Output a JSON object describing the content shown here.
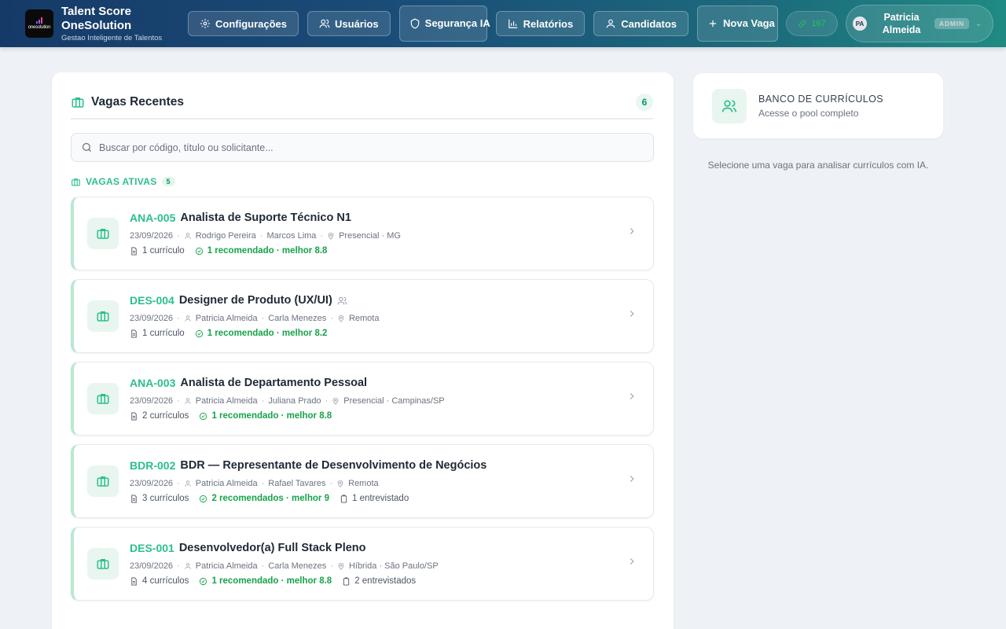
{
  "header": {
    "logo_text": "onesolution",
    "brand_title": "Talent Score OneSolution",
    "brand_subtitle": "Gestao Inteligente de Talentos",
    "nav": {
      "config": "Configurações",
      "users": "Usuários",
      "security": "Segurança IA",
      "reports": "Relatórios",
      "candidates": "Candidatos",
      "new_job": "Nova Vaga"
    },
    "link_count": "167",
    "user": {
      "initials": "PA",
      "name": "Patricia Almeida",
      "role": "ADMIN"
    }
  },
  "panel": {
    "title": "Vagas Recentes",
    "count": "6",
    "search_placeholder": "Buscar por código, título ou solicitante...",
    "section_label": "VAGAS ATIVAS",
    "section_count": "5"
  },
  "jobs": [
    {
      "code": "ANA-005",
      "title": "Analista de Suporte Técnico N1",
      "date": "23/09/2026",
      "requester": "Rodrigo Pereira",
      "recruiter": "Marcos Lima",
      "location": "Presencial · MG",
      "resumes": "1 currículo",
      "recommended": "1 recomendado · melhor 8.8",
      "interviewed": ""
    },
    {
      "code": "DES-004",
      "title": "Designer de Produto (UX/UI)",
      "date": "23/09/2026",
      "requester": "Patricia Almeida",
      "recruiter": "Carla Menezes",
      "location": "Remota",
      "resumes": "1 currículo",
      "recommended": "1 recomendado · melhor 8.2",
      "interviewed": ""
    },
    {
      "code": "ANA-003",
      "title": "Analista de Departamento Pessoal",
      "date": "23/09/2026",
      "requester": "Patricia Almeida",
      "recruiter": "Juliana Prado",
      "location": "Presencial · Campinas/SP",
      "resumes": "2 currículos",
      "recommended": "1 recomendado · melhor 8.8",
      "interviewed": ""
    },
    {
      "code": "BDR-002",
      "title": "BDR — Representante de Desenvolvimento de Negócios",
      "date": "23/09/2026",
      "requester": "Patricia Almeida",
      "recruiter": "Rafael Tavares",
      "location": "Remota",
      "resumes": "3 currículos",
      "recommended": "2 recomendados · melhor 9",
      "interviewed": "1 entrevistado"
    },
    {
      "code": "DES-001",
      "title": "Desenvolvedor(a) Full Stack Pleno",
      "date": "23/09/2026",
      "requester": "Patricia Almeida",
      "recruiter": "Carla Menezes",
      "location": "Híbrida · São Paulo/SP",
      "resumes": "4 currículos",
      "recommended": "1 recomendado · melhor 8.8",
      "interviewed": "2 entrevistados"
    }
  ],
  "side": {
    "bank_title": "BANCO DE CURRÍCULOS",
    "bank_subtitle": "Acesse o pool completo",
    "hint": "Selecione uma vaga para analisar currículos com IA."
  },
  "colors": {
    "accent": "#2bbf8e",
    "success": "#16a34a",
    "header_start": "#163a68",
    "header_end": "#1f8a82"
  },
  "icons": {
    "config": "gear-icon",
    "users": "users-icon",
    "security": "shield-icon",
    "reports": "bar-chart-icon",
    "candidates": "user-icon",
    "new_job": "plus-icon",
    "jobs": "briefcase-icon",
    "search": "search-icon",
    "bank": "users-icon"
  }
}
